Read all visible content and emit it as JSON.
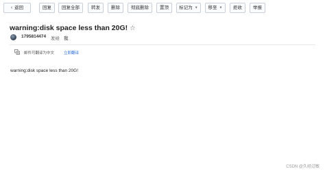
{
  "toolbar": {
    "back_label": "返回",
    "reply_label": "回复",
    "reply_all_label": "回复全部",
    "forward_label": "转发",
    "delete_label": "删除",
    "permanent_delete_label": "彻底删除",
    "pin_label": "置顶",
    "mark_as_label": "标记为",
    "move_to_label": "移至",
    "reject_label": "拒收",
    "report_label": "举报"
  },
  "email": {
    "subject": "warning:disk space less than 20G!",
    "star_icon": "☆",
    "sender": "1795814474",
    "sent_to_label": "发给",
    "recipient": "我",
    "translate_notice": "邮件可翻译为中文",
    "translate_link": "立即翻译",
    "body": "warning:disk space less than 20G!"
  },
  "watermark": "CSDN @久经过敏"
}
